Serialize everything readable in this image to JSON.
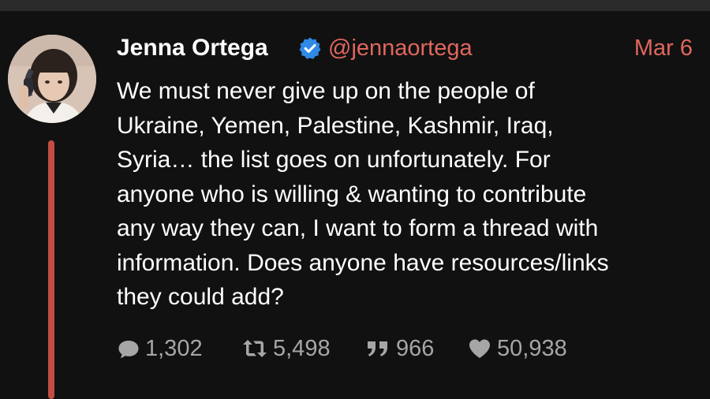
{
  "tweet": {
    "author_name": "Jenna Ortega",
    "handle": "@jennaortega",
    "date": "Mar 6",
    "verified": true,
    "text_lines": [
      "We must never give up on the people of",
      "Ukraine, Yemen, Palestine, Kashmir, Iraq,",
      "Syria… the list goes on unfortunately. For",
      "anyone who is willing & wanting to contribute",
      "any way they can, I want to form a thread with",
      "information. Does anyone have resources/links",
      "they could add?"
    ],
    "actions": {
      "replies": "1,302",
      "retweets": "5,498",
      "quotes": "966",
      "likes": "50,938"
    }
  },
  "colors": {
    "background": "#111111",
    "accent": "#e0675d",
    "thread_line": "#c24d44",
    "verified_badge": "#2f8ae6",
    "muted": "#a6a6a6"
  },
  "icons": {
    "verified": "verified-badge-icon",
    "reply": "speech-bubble-icon",
    "retweet": "retweet-icon",
    "quote": "quote-icon",
    "like": "heart-icon"
  }
}
